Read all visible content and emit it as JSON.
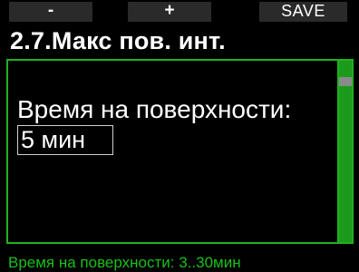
{
  "softkeys": {
    "minus_label": "-",
    "plus_label": "+",
    "save_label": "SAVE"
  },
  "header": {
    "title": "2.7.Макс пов. инт."
  },
  "panel": {
    "field_label": "Время на поверхности:",
    "field_value": "5 мин"
  },
  "footer": {
    "hint": "Время на поверхности: 3..30мин"
  },
  "colors": {
    "accent_green": "#1fb31f",
    "background": "#000000",
    "softkey_bg": "#2a2a2a"
  }
}
